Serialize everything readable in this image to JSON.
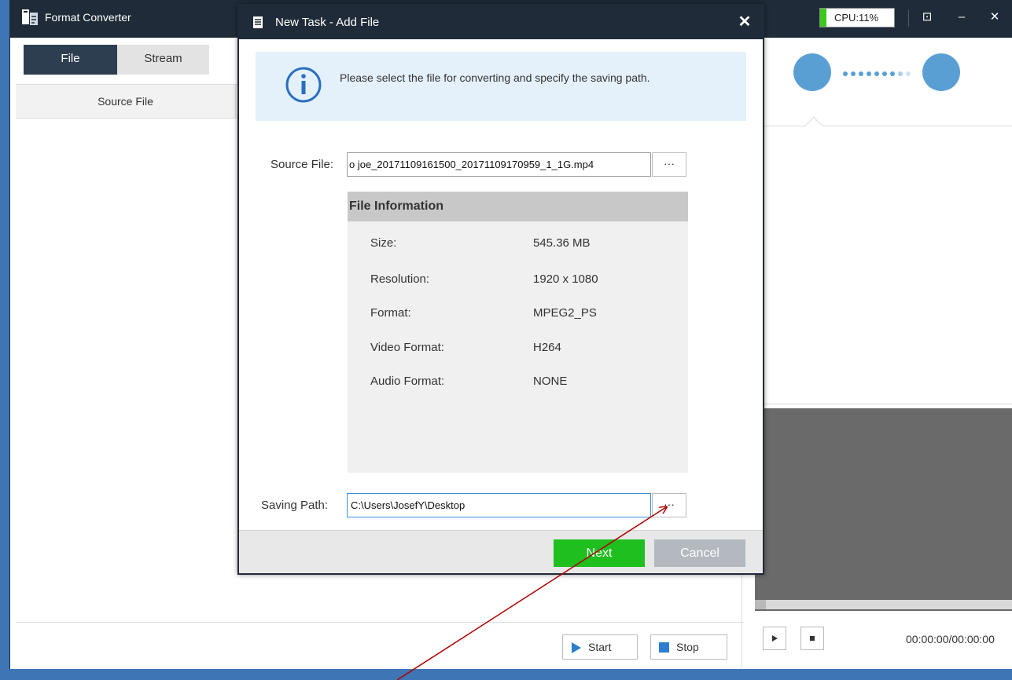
{
  "app": {
    "title": "Format Converter",
    "cpu_label": "CPU:11%",
    "restore_glyph": "⊡",
    "minimize_glyph": "–",
    "close_glyph": "✕"
  },
  "tabs": {
    "file": "File",
    "stream": "Stream"
  },
  "table": {
    "col_source": "Source File"
  },
  "controls": {
    "start": "Start",
    "stop": "Stop"
  },
  "player": {
    "timecode": "00:00:00/00:00:00"
  },
  "dialog": {
    "title": "New Task - Add File",
    "info": "Please select the file for converting and specify the saving path.",
    "source_label": "Source File:",
    "source_value": "o joe_20171109161500_20171109170959_1_1G.mp4",
    "browse_label": "···",
    "file_info_title": "File Information",
    "file_info": [
      {
        "key": "Size:",
        "value": "545.36 MB"
      },
      {
        "key": "Resolution:",
        "value": "1920 x 1080"
      },
      {
        "key": "Format:",
        "value": "MPEG2_PS"
      },
      {
        "key": "Video Format:",
        "value": "H264"
      },
      {
        "key": "Audio Format:",
        "value": "NONE"
      }
    ],
    "saving_label": "Saving Path:",
    "saving_value": "C:\\Users\\JosefY\\Desktop",
    "next": "Next",
    "cancel": "Cancel"
  },
  "colors": {
    "titlebar": "#1f2b38",
    "accent_blue": "#5a9fd4",
    "next_green": "#1fbf1f",
    "cpu_green": "#3cc81c",
    "annotation_arrow": "#b00000"
  },
  "icons": [
    "app-logo-icon",
    "document-icon",
    "info-icon",
    "play-icon",
    "stop-icon",
    "ellipsis-icon"
  ]
}
